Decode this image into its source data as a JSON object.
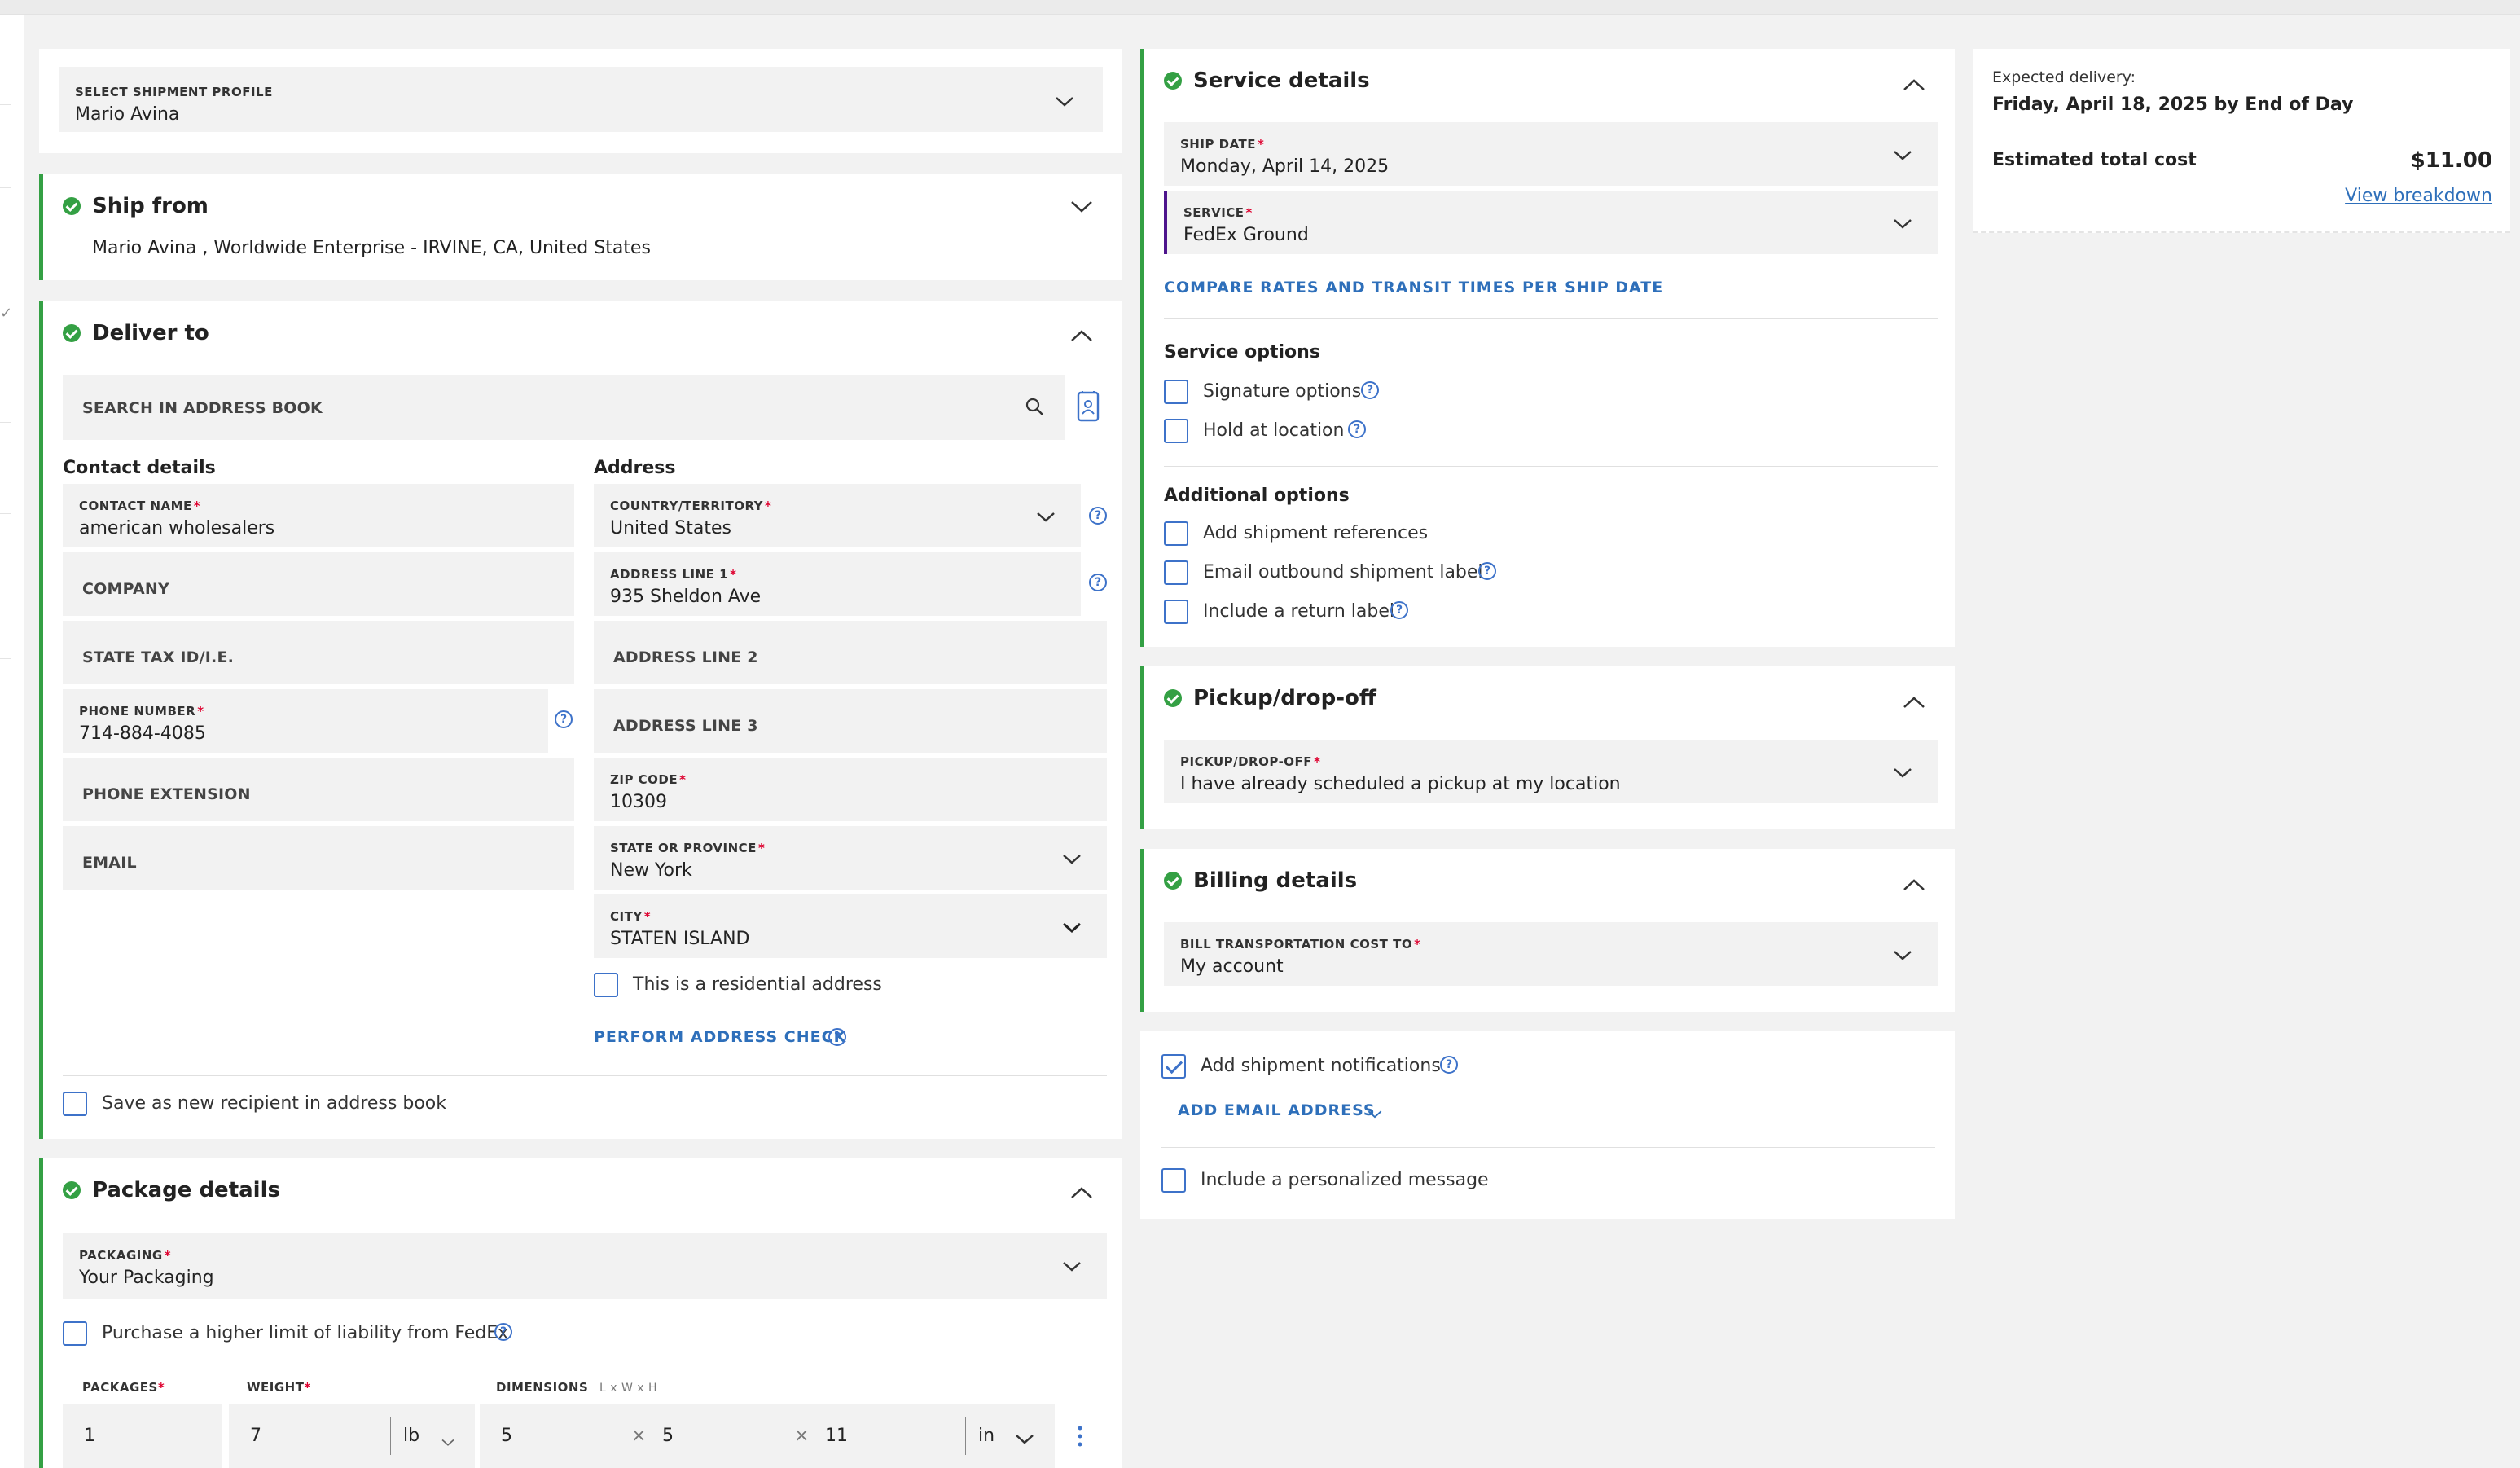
{
  "shipment_profile": {
    "label": "SELECT SHIPMENT PROFILE",
    "value": "Mario Avina"
  },
  "ship_from": {
    "title": "Ship from",
    "address": "Mario Avina , Worldwide Enterprise - IRVINE, CA, United States"
  },
  "deliver_to": {
    "title": "Deliver to",
    "search_placeholder": "SEARCH IN ADDRESS BOOK",
    "contact_heading": "Contact details",
    "address_heading": "Address",
    "contact_name": {
      "label": "CONTACT NAME",
      "value": "american wholesalers"
    },
    "company": {
      "label": "COMPANY"
    },
    "state_tax": {
      "label": "STATE TAX ID/I.E."
    },
    "phone": {
      "label": "PHONE NUMBER",
      "value": "714-884-4085"
    },
    "phone_ext": {
      "label": "PHONE EXTENSION"
    },
    "email": {
      "label": "EMAIL"
    },
    "country": {
      "label": "COUNTRY/TERRITORY",
      "value": "United States"
    },
    "address1": {
      "label": "ADDRESS LINE 1",
      "value": "935 Sheldon Ave"
    },
    "address2": {
      "label": "ADDRESS LINE 2"
    },
    "address3": {
      "label": "ADDRESS LINE 3"
    },
    "zip": {
      "label": "ZIP CODE",
      "value": "10309"
    },
    "state": {
      "label": "STATE OR PROVINCE",
      "value": "New York"
    },
    "city": {
      "label": "CITY",
      "value": "STATEN ISLAND"
    },
    "residential_label": "This is a residential address",
    "address_check": "PERFORM ADDRESS CHECK",
    "save_recipient": "Save as new recipient in address book"
  },
  "package_details": {
    "title": "Package details",
    "packaging": {
      "label": "PACKAGING",
      "value": "Your Packaging"
    },
    "liability_label": "Purchase a higher limit of liability from FedEx",
    "packages_label": "PACKAGES",
    "weight_label": "WEIGHT",
    "dimensions_label": "DIMENSIONS",
    "dimensions_hint": "L x W x H",
    "packages_value": "1",
    "weight_value": "7",
    "weight_unit": "lb",
    "dim_l": "5",
    "dim_w": "5",
    "dim_h": "11",
    "dim_unit": "in",
    "times": "×"
  },
  "service_details": {
    "title": "Service details",
    "ship_date": {
      "label": "SHIP DATE",
      "value": "Monday, April 14, 2025"
    },
    "service": {
      "label": "SERVICE",
      "value": "FedEx Ground"
    },
    "compare_link": "COMPARE RATES AND TRANSIT TIMES PER SHIP DATE",
    "service_options_heading": "Service options",
    "signature": "Signature options",
    "hold": "Hold at location",
    "additional_heading": "Additional options",
    "references": "Add shipment references",
    "email_label": "Email outbound shipment label",
    "return_label": "Include a return label"
  },
  "pickup": {
    "title": "Pickup/drop-off",
    "label": "PICKUP/DROP-OFF",
    "value": "I have already scheduled a pickup at my location"
  },
  "billing": {
    "title": "Billing details",
    "label": "BILL TRANSPORTATION COST TO",
    "value": "My account"
  },
  "notifications": {
    "add_notifications": "Add shipment notifications",
    "add_email": "ADD EMAIL ADDRESS",
    "personal_message": "Include a personalized message"
  },
  "summary": {
    "expected_label": "Expected delivery:",
    "expected_value": "Friday, April 18, 2025 by End of Day",
    "cost_label": "Estimated total cost",
    "cost_value": "$11.00",
    "breakdown_link": "View breakdown"
  },
  "colors": {
    "accent_green": "#34a044",
    "link_blue": "#2e6fba",
    "fedex_purple": "#4d148c",
    "required_red": "#de002e"
  },
  "icons": [
    "search-icon",
    "address-book-icon",
    "chevron-down-icon",
    "chevron-up-icon",
    "help-icon",
    "check-circle-icon",
    "more-vertical-icon"
  ]
}
